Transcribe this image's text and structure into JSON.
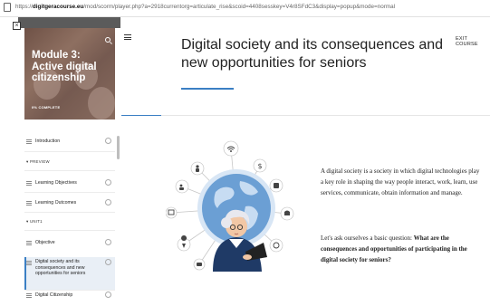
{
  "browser": {
    "url_prefix": "https://",
    "url_domain": "digitgeracourse.eu",
    "url_rest": "/mod/scorm/player.php?a=2918currentorg=articulate_rise&scoid=4408sesskey=V4r8SFdC3&display=popup&mode=normal"
  },
  "sidebar": {
    "collapse_icon": "×",
    "module_title": "Module 3: Active digital citizenship",
    "progress_text": "0% COMPLETE",
    "items": [
      {
        "label": "Introduction",
        "type": "lesson"
      },
      {
        "label": "PREVIEW",
        "type": "section"
      },
      {
        "label": "Learning Objectives",
        "type": "lesson"
      },
      {
        "label": "Learning Outcomes",
        "type": "lesson"
      },
      {
        "label": "UNIT1",
        "type": "section"
      },
      {
        "label": "Objective",
        "type": "lesson"
      },
      {
        "label": "Digital society and its consequences and new opportunities for seniors",
        "type": "lesson",
        "active": true
      },
      {
        "label": "Digital Citizenship",
        "type": "lesson"
      }
    ]
  },
  "main": {
    "title": "Digital society and its consequences and new opportunities for seniors",
    "exit_label": "EXIT COURSE",
    "paragraph1": "A digital society is a society in which digital technologies play a key role in shaping the way people interact, work, learn, use services, communicate, obtain information and manage.",
    "paragraph2_normal": "Let's ask ourselves a basic question: ",
    "paragraph2_bold": "What are the consequences and opportunities of participating in the digital society for seniors?"
  },
  "colors": {
    "accent": "#3b7fc4",
    "hero_overlay": "#6e4641",
    "globe": "#6b9fd4"
  }
}
